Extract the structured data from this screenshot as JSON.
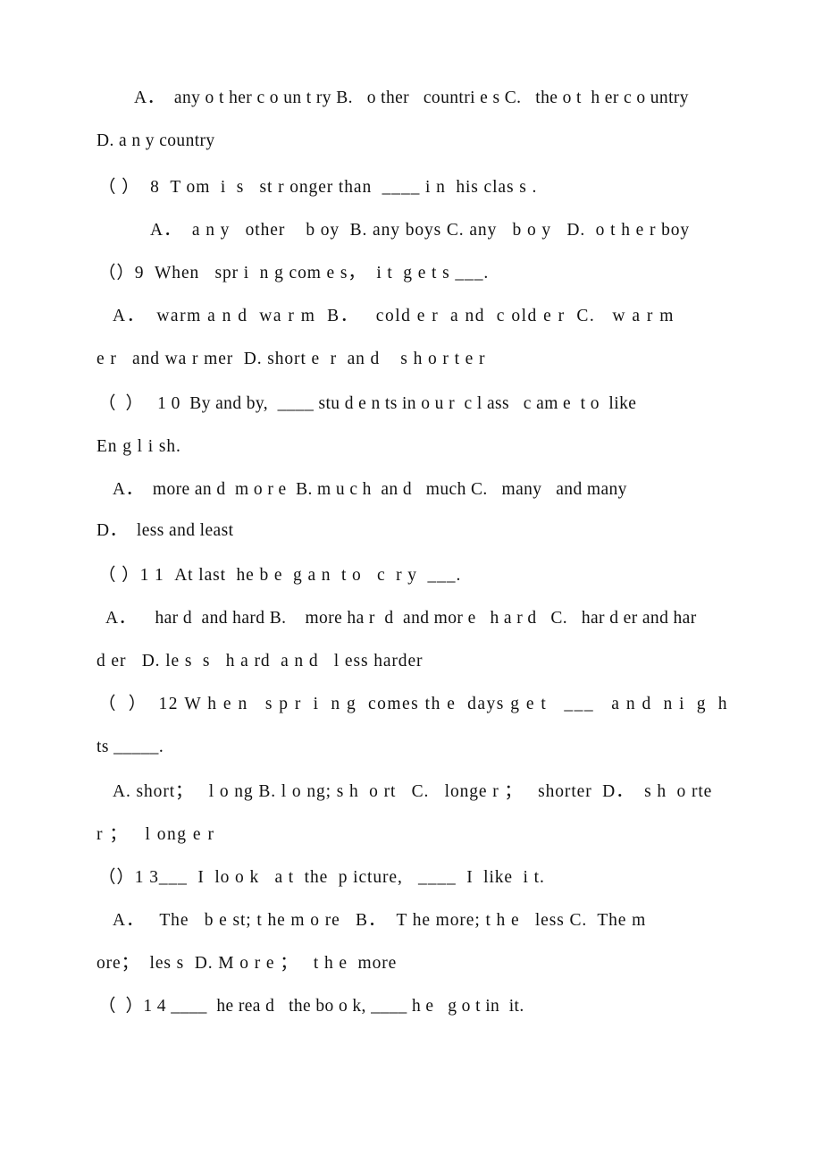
{
  "document": {
    "type": "scanned-worksheet",
    "subject": "English grammar multiple-choice exercise",
    "topic": "comparative and superlative forms",
    "page_background": "#ffffff",
    "text_color": "#111111",
    "questions_range": "7 (options only) through 14"
  },
  "lines": [
    {
      "id": "l1",
      "text": "A．  any o t her c o un t ry B.   o ther   countri e s C.   the o t  h er c o untry"
    },
    {
      "id": "l2",
      "text": "D. a n y country"
    },
    {
      "id": "l3",
      "text": "（ ）  8  T om  i  s   st r onger than  ____ i n  his clas s ."
    },
    {
      "id": "l4",
      "text": "A．  a n y   other    b oy  B. any boys C. any   b o y   D.  o t h e r boy"
    },
    {
      "id": "l5",
      "text": "（）9  When   spr i  n g com e s，  i t  g e t s ___."
    },
    {
      "id": "l6",
      "text": "A．  warm a n d  wa r m  B．   cold e r  a nd  c old e r  C.   w a r m"
    },
    {
      "id": "l7",
      "text": "e r   and wa r mer  D. short e  r  an d    s h o r t e r"
    },
    {
      "id": "l8",
      "text": "（  ）   1 0  By and by,  ____ stu d e n ts in o u r  c l ass   c am e  t o  like"
    },
    {
      "id": "l9",
      "text": "En g l i sh."
    },
    {
      "id": "l10",
      "text": "A．  more an d  m o r e  B. m u c h  an d   much C.   many   and many"
    },
    {
      "id": "l11",
      "text": "D．  less and least"
    },
    {
      "id": "l12",
      "text": "（ ）1 1  At last  he b e  g a n  t o   c  r y  ___."
    },
    {
      "id": "l13",
      "text": "A．    har d  and hard B.    more ha r  d  and mor e   h a r d   C.   har d er and har"
    },
    {
      "id": "l14",
      "text": "d er   D. le s  s   h a rd  a n d   l ess harder"
    },
    {
      "id": "l15",
      "text": "（  ）  12 W h e n   s p r  i  n g  comes th e  days g e t   ___   a n d  n i  g  h"
    },
    {
      "id": "l16",
      "text": "ts _____."
    },
    {
      "id": "l17",
      "text": "A. short；   l o ng B. l o ng; s h  o rt   C.   longe r ；   shorter  D．  s h  o rte"
    },
    {
      "id": "l18",
      "text": "r ；   l ong e r"
    },
    {
      "id": "l19",
      "text": "（）1 3___  I  lo o k   a t  the  p icture,   ____  I  like  i t."
    },
    {
      "id": "l20",
      "text": "A．   The   b e st; t he m o re   B．  T he more; t h e   less C.  The m"
    },
    {
      "id": "l21",
      "text": "ore；  les s  D. M o r e ；   t h e  more"
    },
    {
      "id": "l22",
      "text": "（  ）1 4 ____  he rea d   the bo o k, ____ h e   g o t in  it."
    }
  ],
  "layout": {
    "line_tops": [
      95,
      143,
      195,
      243,
      291,
      339,
      387,
      437,
      485,
      533,
      579,
      629,
      677,
      725,
      773,
      821,
      871,
      919,
      967,
      1015,
      1063,
      1111
    ],
    "indent_classes": [
      "ind-4",
      "ind-0",
      "ind-1",
      "ind-5",
      "ind-1",
      "ind-3",
      "ind-0",
      "ind-1",
      "ind-0",
      "ind-3",
      "ind-0",
      "ind-1",
      "ind-2",
      "ind-0",
      "ind-1",
      "ind-0",
      "ind-3",
      "ind-0",
      "ind-1",
      "ind-3",
      "ind-0",
      "ind-1"
    ],
    "spacing_classes": [
      "sp-a",
      "sp-a",
      "sp-b",
      "sp-b",
      "sp-b",
      "sp-c",
      "sp-b",
      "sp-a",
      "sp-b",
      "sp-a",
      "sp-a",
      "sp-b",
      "sp-a",
      "sp-b",
      "sp-c",
      "sp-a",
      "sp-b",
      "sp-c",
      "sp-b",
      "sp-b",
      "sp-b",
      "sp-a"
    ]
  }
}
